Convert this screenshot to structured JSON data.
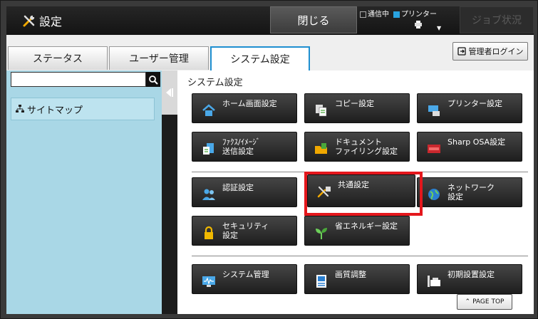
{
  "header": {
    "title": "設定",
    "close_label": "閉じる",
    "status_comm": "通信中",
    "status_printer": "プリンター",
    "job_status_label": "ジョブ状況",
    "accent": "#29a3e0"
  },
  "tabs": [
    {
      "label": "ステータス"
    },
    {
      "label": "ユーザー管理"
    },
    {
      "label": "システム設定"
    }
  ],
  "admin_login_label": "管理者ログイン",
  "sidebar": {
    "search_value": "",
    "sitemap_label": "サイトマップ"
  },
  "main": {
    "title": "システム設定",
    "tiles": [
      {
        "label": "ホーム画面設定",
        "icon": "home-icon"
      },
      {
        "label": "コピー設定",
        "icon": "copy-icon"
      },
      {
        "label": "プリンター設定",
        "icon": "printer-icon"
      },
      {
        "label": "ﾌｧｸｽ/ｲﾒｰｼﾞ\n送信設定",
        "icon": "fax-image-send-icon"
      },
      {
        "label": "ドキュメント\nファイリング設定",
        "icon": "folder-icon"
      },
      {
        "label": "Sharp OSA設定",
        "icon": "osa-icon"
      },
      {
        "label": "認証設定",
        "icon": "users-icon"
      },
      {
        "label": "共通設定",
        "icon": "tools-icon"
      },
      {
        "label": "ネットワーク\n設定",
        "icon": "globe-icon"
      },
      {
        "label": "セキュリティ\n設定",
        "icon": "lock-icon"
      },
      {
        "label": "省エネルギー設定",
        "icon": "leaf-icon"
      },
      {
        "label": "システム管理",
        "icon": "monitor-icon"
      },
      {
        "label": "画質調整",
        "icon": "image-quality-icon"
      },
      {
        "label": "初期設置設定",
        "icon": "installation-icon"
      }
    ],
    "page_top_label": "PAGE TOP"
  }
}
